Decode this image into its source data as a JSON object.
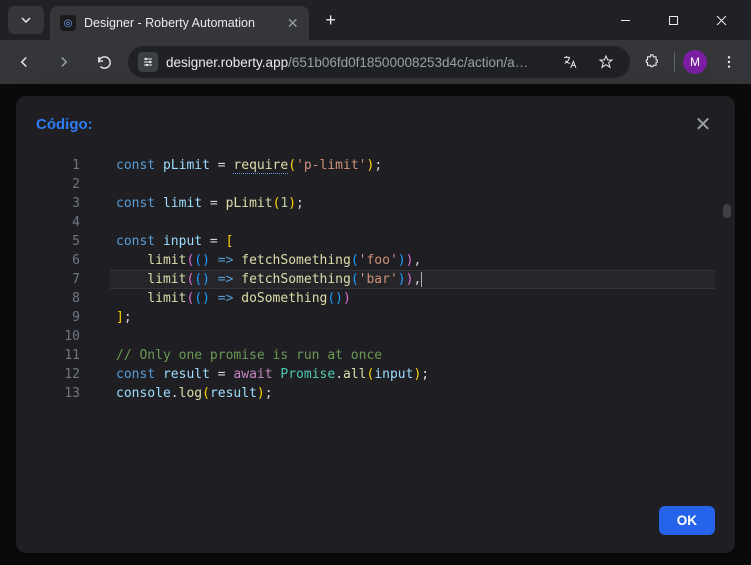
{
  "window": {
    "tab_title": "Designer - Roberty Automation",
    "url_domain": "designer.roberty.app",
    "url_path": "/651b06fd0f18500008253d4c/action/a…",
    "avatar_letter": "M"
  },
  "modal": {
    "title": "Código:",
    "ok_label": "OK"
  },
  "editor": {
    "active_line": 7,
    "lines": [
      {
        "n": 1,
        "tokens": [
          [
            "kw",
            "const "
          ],
          [
            "var",
            "pLimit"
          ],
          [
            "",
            " = "
          ],
          [
            "fn squiggle",
            "require"
          ],
          [
            "p1",
            "("
          ],
          [
            "str",
            "'p-limit'"
          ],
          [
            "p1",
            ")"
          ],
          [
            "",
            ";"
          ]
        ]
      },
      {
        "n": 2,
        "tokens": []
      },
      {
        "n": 3,
        "tokens": [
          [
            "kw",
            "const "
          ],
          [
            "var",
            "limit"
          ],
          [
            "",
            " = "
          ],
          [
            "fn",
            "pLimit"
          ],
          [
            "p1",
            "("
          ],
          [
            "num",
            "1"
          ],
          [
            "p1",
            ")"
          ],
          [
            "",
            ";"
          ]
        ]
      },
      {
        "n": 4,
        "tokens": []
      },
      {
        "n": 5,
        "tokens": [
          [
            "kw",
            "const "
          ],
          [
            "var",
            "input"
          ],
          [
            "",
            " = "
          ],
          [
            "p1",
            "["
          ]
        ]
      },
      {
        "n": 6,
        "tokens": [
          [
            "",
            "    "
          ],
          [
            "fn",
            "limit"
          ],
          [
            "p2",
            "("
          ],
          [
            "p3",
            "("
          ],
          [
            "p3",
            ")"
          ],
          [
            "",
            " "
          ],
          [
            "kw",
            "=>"
          ],
          [
            "",
            " "
          ],
          [
            "fn",
            "fetchSomething"
          ],
          [
            "p3",
            "("
          ],
          [
            "str",
            "'foo'"
          ],
          [
            "p3",
            ")"
          ],
          [
            "p2",
            ")"
          ],
          [
            "",
            ","
          ]
        ]
      },
      {
        "n": 7,
        "tokens": [
          [
            "",
            "    "
          ],
          [
            "fn",
            "limit"
          ],
          [
            "p2",
            "("
          ],
          [
            "p3",
            "("
          ],
          [
            "p3",
            ")"
          ],
          [
            "",
            " "
          ],
          [
            "kw",
            "=>"
          ],
          [
            "",
            " "
          ],
          [
            "fn",
            "fetchSomething"
          ],
          [
            "p3",
            "("
          ],
          [
            "str",
            "'bar'"
          ],
          [
            "p3",
            ")"
          ],
          [
            "p2",
            ")"
          ],
          [
            "",
            ","
          ]
        ]
      },
      {
        "n": 8,
        "tokens": [
          [
            "",
            "    "
          ],
          [
            "fn",
            "limit"
          ],
          [
            "p2",
            "("
          ],
          [
            "p3",
            "("
          ],
          [
            "p3",
            ")"
          ],
          [
            "",
            " "
          ],
          [
            "kw",
            "=>"
          ],
          [
            "",
            " "
          ],
          [
            "fn",
            "doSomething"
          ],
          [
            "p3",
            "("
          ],
          [
            "p3",
            ")"
          ],
          [
            "p2",
            ")"
          ]
        ]
      },
      {
        "n": 9,
        "tokens": [
          [
            "p1",
            "]"
          ],
          [
            "",
            ";"
          ]
        ]
      },
      {
        "n": 10,
        "tokens": []
      },
      {
        "n": 11,
        "tokens": [
          [
            "cmt",
            "// Only one promise is run at once"
          ]
        ]
      },
      {
        "n": 12,
        "tokens": [
          [
            "kw",
            "const "
          ],
          [
            "var",
            "result"
          ],
          [
            "",
            " = "
          ],
          [
            "kw2",
            "await"
          ],
          [
            "",
            " "
          ],
          [
            "cls",
            "Promise"
          ],
          [
            "",
            "."
          ],
          [
            "fn",
            "all"
          ],
          [
            "p1",
            "("
          ],
          [
            "var",
            "input"
          ],
          [
            "p1",
            ")"
          ],
          [
            "",
            ";"
          ]
        ]
      },
      {
        "n": 13,
        "tokens": [
          [
            "var",
            "console"
          ],
          [
            "",
            "."
          ],
          [
            "fn",
            "log"
          ],
          [
            "p1",
            "("
          ],
          [
            "var",
            "result"
          ],
          [
            "p1",
            ")"
          ],
          [
            "",
            ";"
          ]
        ]
      }
    ]
  }
}
